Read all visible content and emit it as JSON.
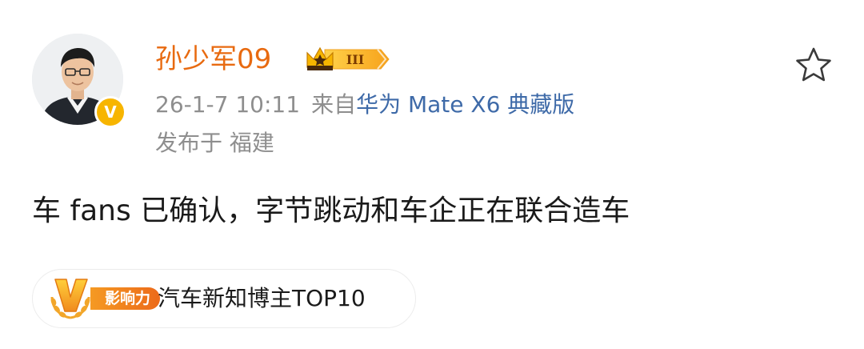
{
  "user": {
    "name": "孙少军09",
    "level_badge": "III",
    "verified_mark": "V"
  },
  "meta": {
    "time": "26-1-7 10:11",
    "source_prefix": "来自",
    "device": "华为 Mate X6 典藏版",
    "location": "发布于 福建"
  },
  "post": {
    "text": "车 fans 已确认，字节跳动和车企正在联合造车"
  },
  "tag": {
    "influence_label": "影响力",
    "text": "汽车新知博主TOP10"
  },
  "icons": {
    "favorite": "star-outline-icon",
    "level": "crown-level-icon",
    "influence": "v-influence-logo-icon"
  },
  "colors": {
    "username": "#e86a10",
    "device_link": "#3e6aa8",
    "meta_gray": "#8e8e8e",
    "verified": "#f7b500",
    "influence_orange": "#f08a1e"
  }
}
